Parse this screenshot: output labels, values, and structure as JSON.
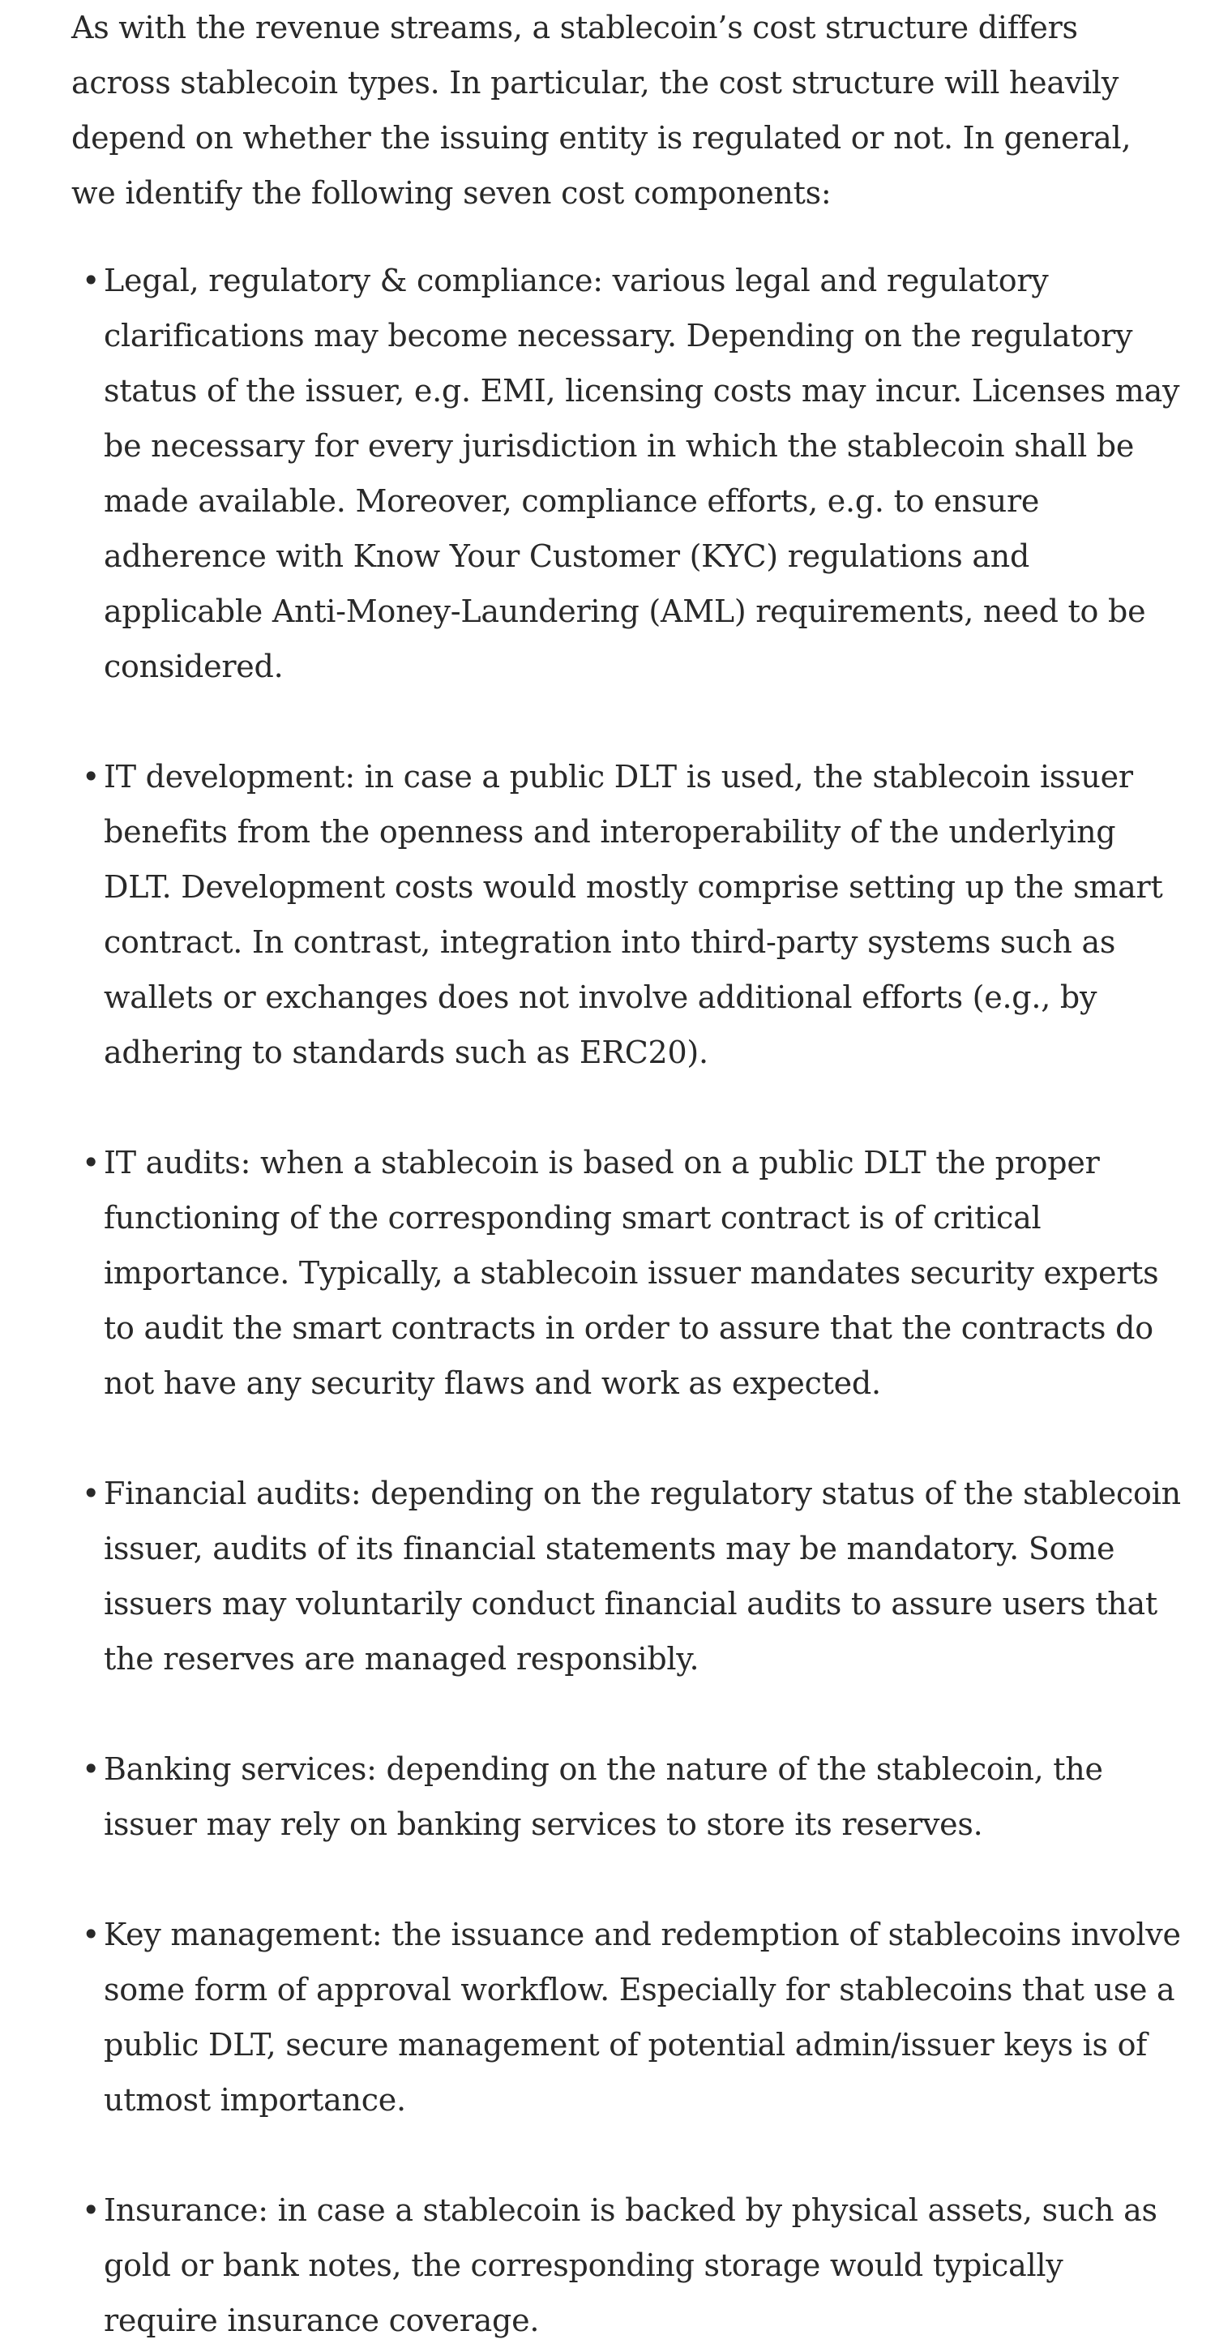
{
  "article": {
    "intro": "As with the revenue streams, a stablecoin’s cost structure differs across stablecoin types. In particular, the cost structure will heavily depend on whether the issuing entity is regulated or not. In general, we identify the following seven cost components:",
    "bullet_glyph": "•",
    "items": [
      {
        "text": "Legal, regulatory & compliance: various legal and regulatory clarifications may become necessary. Depending on the regulatory status of the issuer, e.g. EMI, licensing costs may incur. Licenses may be necessary for every jurisdiction in which the stablecoin shall be made available. Moreover, compliance efforts, e.g. to ensure adherence with Know Your Customer (KYC) regulations and applicable Anti-Money-Laundering (AML) requirements, need to be considered."
      },
      {
        "text": "IT development: in case a public DLT is used, the stablecoin issuer benefits from the openness and interoperability of the underlying DLT. Development costs would mostly comprise setting up the smart contract. In contrast, integration into third-party systems such as wallets or exchanges does not involve additional efforts (e.g., by adhering to standards such as ERC20)."
      },
      {
        "text": "IT audits: when a stablecoin is based on a public DLT the proper functioning of the corresponding smart contract is of critical importance. Typically, a stablecoin issuer mandates security experts to audit the smart contracts in order to assure that the contracts do not have any security flaws and work as expected."
      },
      {
        "text": "Financial audits: depending on the regulatory status of the stablecoin issuer, audits of its financial statements may be mandatory. Some issuers may voluntarily conduct financial audits to assure users that the reserves are managed responsibly."
      },
      {
        "text": "Banking services: depending on the nature of the stablecoin, the issuer may rely on banking services to store its reserves."
      },
      {
        "text": "Key management: the issuance and redemption of stablecoins involve some form of approval workflow. Especially for stablecoins that use a public DLT, secure management of potential admin/issuer keys is of utmost importance."
      },
      {
        "text": "Insurance: in case a stablecoin is backed by physical assets, such as gold or bank notes, the corresponding storage would typically require insurance coverage."
      }
    ]
  }
}
